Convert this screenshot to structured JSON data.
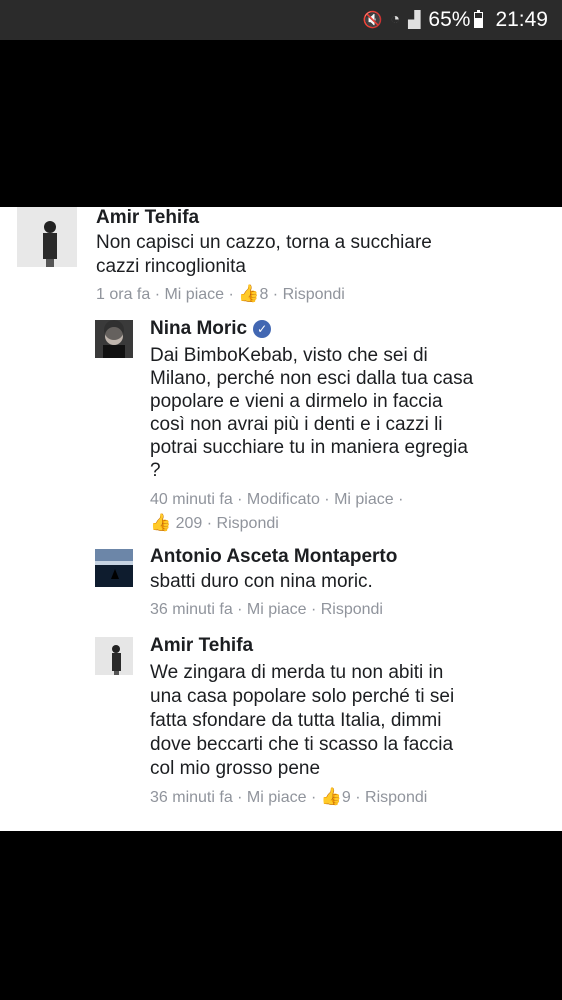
{
  "status_bar": {
    "mute_icon": "mute-icon",
    "wifi_icon": "wifi-icon",
    "signal_icon": "signal-icon",
    "battery": "65%",
    "battery_level": 0.65,
    "time": "21:49"
  },
  "comments": [
    {
      "name": "Amir Tehifa",
      "lines": [
        "Non capisci un cazzo, torna a succhiare",
        "cazzi rincoglionita"
      ],
      "meta": "1 ora fa · Mi piace · ",
      "likes": "8",
      "reply": " · Rispondi"
    },
    {
      "name": "Nina Moric",
      "verified": true,
      "lines": [
        "Dai BimboKebab, visto che sei di",
        "Milano, perché non esci dalla tua casa",
        "popolare e vieni a dirmelo in faccia",
        "così non avrai più i denti e i cazzi li",
        "potrai succhiare tu in maniera egregia",
        "?"
      ],
      "meta": "40 minuti fa · Modificato · Mi piace ·",
      "likes": "209",
      "reply": " · Rispondi"
    },
    {
      "name": "Antonio Asceta Montaperto",
      "lines": [
        "sbatti duro con nina moric."
      ],
      "meta": "36 minuti fa · Mi piace · Rispondi"
    },
    {
      "name": "Amir Tehifa",
      "lines": [
        "We zingara di merda tu non abiti in",
        "una casa popolare solo perché ti sei",
        "fatta sfondare da tutta Italia, dimmi",
        "dove beccarti che ti scasso la faccia",
        "col mio grosso pene"
      ],
      "meta": "36 minuti fa · Mi piace · ",
      "likes": "9",
      "reply": " · Rispondi"
    }
  ]
}
